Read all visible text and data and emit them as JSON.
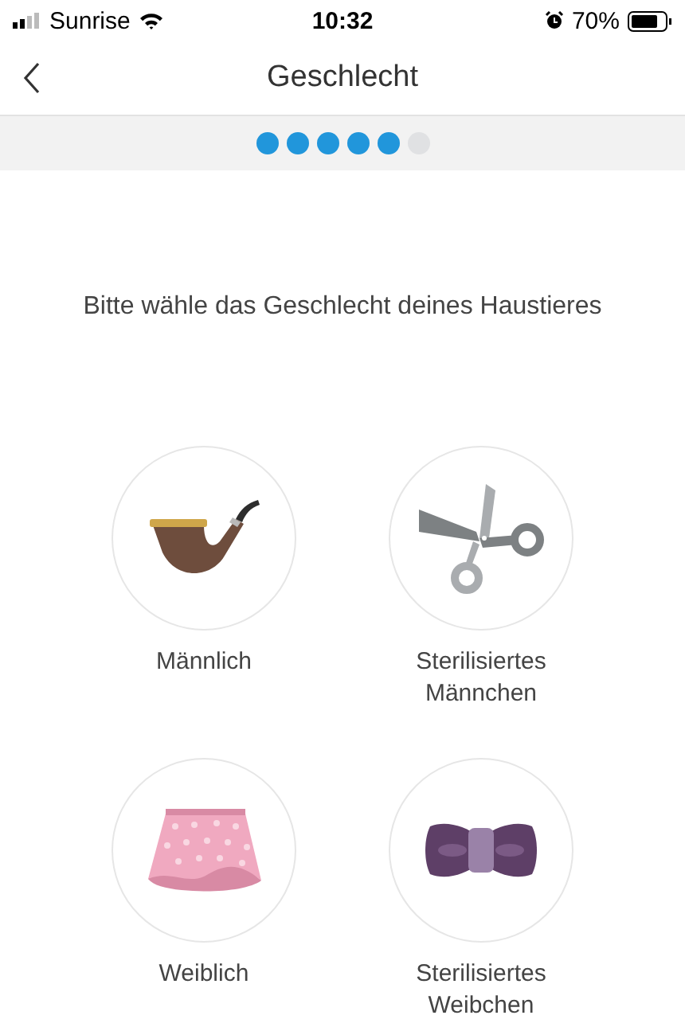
{
  "status_bar": {
    "carrier": "Sunrise",
    "time": "10:32",
    "battery": "70%"
  },
  "nav": {
    "title": "Geschlecht"
  },
  "progress": [
    {
      "done": true
    },
    {
      "done": true
    },
    {
      "done": true
    },
    {
      "done": true
    },
    {
      "done": true
    },
    {
      "done": false
    }
  ],
  "prompt": "Bitte wähle das Geschlecht deines Haustieres",
  "options": [
    {
      "kind": "pipe",
      "label": "Männlich"
    },
    {
      "kind": "scissors",
      "label": "Sterilisiertes Männchen"
    },
    {
      "kind": "skirt",
      "label": "Weiblich"
    },
    {
      "kind": "bowtie",
      "label": "Sterilisiertes Weibchen"
    }
  ]
}
